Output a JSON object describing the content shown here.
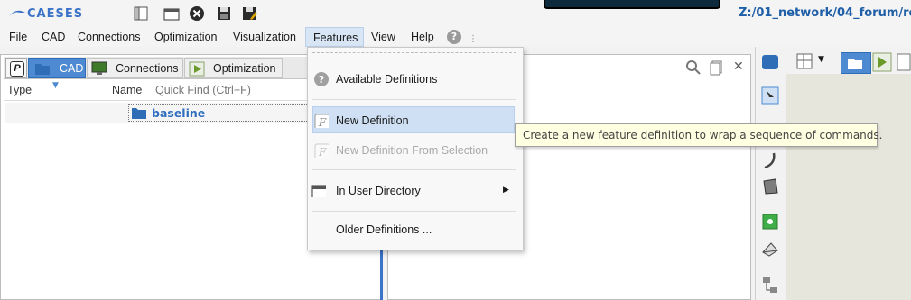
{
  "app": {
    "logo_text": "CAESES",
    "path_title": "Z:/01_network/04_forum/re"
  },
  "menubar": {
    "items": [
      "File",
      "CAD",
      "Connections",
      "Optimization",
      "Visualization",
      "Features",
      "View",
      "Help"
    ],
    "active": "Features"
  },
  "left_panel": {
    "tabs": {
      "p": "P",
      "cad": "CAD",
      "connections": "Connections",
      "optimization": "Optimization"
    },
    "columns": {
      "type": "Type",
      "name": "Name"
    },
    "quick_find_placeholder": "Quick Find (Ctrl+F)",
    "tree": [
      {
        "label": "baseline"
      }
    ]
  },
  "features_menu": {
    "items": [
      {
        "label": "Available Definitions",
        "icon": "help-circle-icon",
        "disabled": false
      },
      {
        "label": "New Definition",
        "icon": "feature-f-icon",
        "disabled": false,
        "highlighted": true
      },
      {
        "label": "New Definition From Selection",
        "icon": "feature-f-icon",
        "disabled": true
      },
      {
        "label": "In User Directory",
        "icon": "folder-icon",
        "disabled": false,
        "submenu": true
      },
      {
        "label": "Older Definitions ...",
        "icon": "",
        "disabled": false
      }
    ]
  },
  "tooltip": {
    "text": "Create a new feature definition to wrap a sequence of commands."
  },
  "colors": {
    "accent": "#4d8ad2",
    "highlight": "#cfe0f4",
    "tooltip_bg": "#ffffe1",
    "path_title": "#1f5fa8"
  }
}
